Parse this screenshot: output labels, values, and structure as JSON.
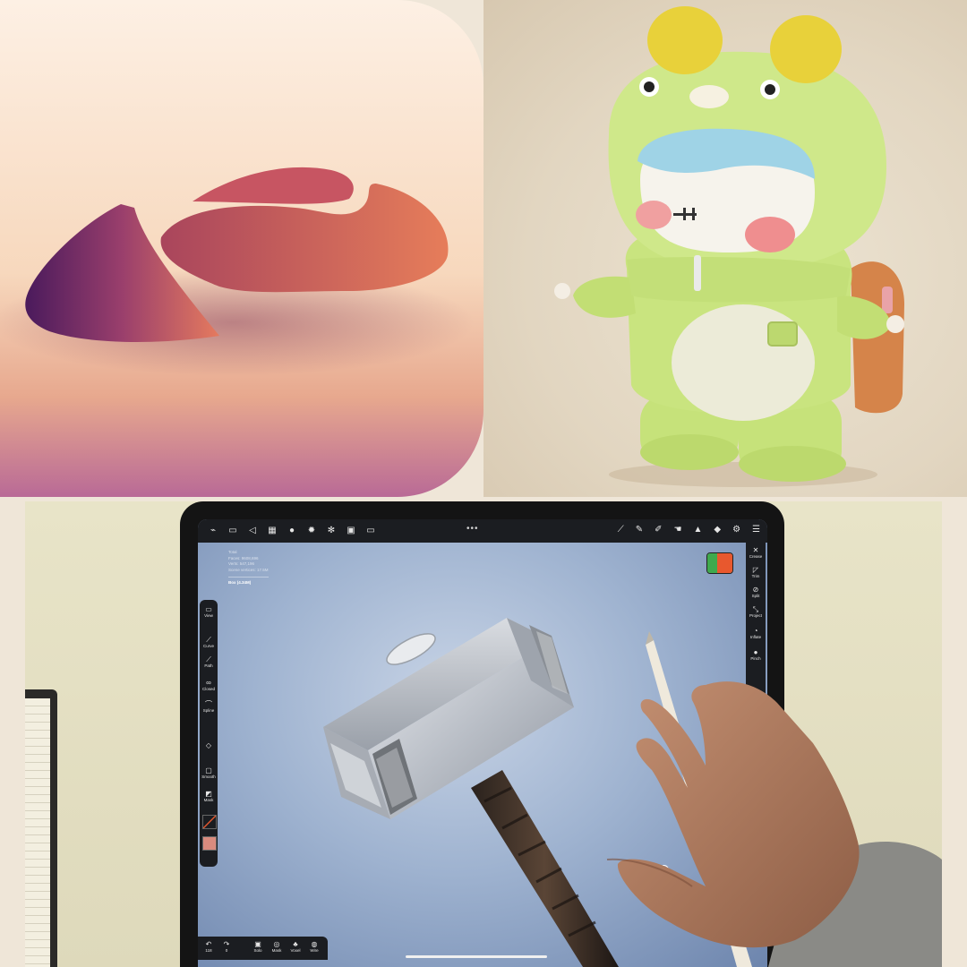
{
  "app_icon": {
    "name": "Nomad Sculpt app icon"
  },
  "viewport": {
    "stats": {
      "line1": "Total",
      "line2": "Faces: 9608,696",
      "line3": "Verts: 547,196",
      "line4": "Scene vertices: 17.5M",
      "selected": "Box (4.34M)"
    },
    "top_menu_dots": "•••"
  },
  "left_toolbar": {
    "items": [
      {
        "icon": "▭",
        "label": "View"
      },
      {
        "icon": "⟋",
        "label": "Curve"
      },
      {
        "icon": "⟋",
        "label": "Path"
      },
      {
        "icon": "∞",
        "label": "Closed"
      },
      {
        "icon": "⌒",
        "label": "Spline"
      },
      {
        "icon": "◇",
        "label": ""
      },
      {
        "icon": "▢",
        "label": "Smooth"
      },
      {
        "icon": "◩",
        "label": "Mask"
      }
    ]
  },
  "right_toolbar": {
    "items": [
      {
        "icon": "✕",
        "label": "Crease"
      },
      {
        "icon": "◸",
        "label": "Trim"
      },
      {
        "icon": "⊘",
        "label": "Split"
      },
      {
        "icon": "⤡",
        "label": "Project"
      },
      {
        "icon": "◔",
        "label": "Inflate"
      },
      {
        "icon": "●",
        "label": "Pinch"
      }
    ]
  },
  "bottom_toolbar": {
    "items": [
      {
        "icon": "↶",
        "label": "118"
      },
      {
        "icon": "↷",
        "label": "0"
      },
      {
        "icon": "▣",
        "label": "Solo"
      },
      {
        "icon": "◎",
        "label": "Mask"
      },
      {
        "icon": "♣",
        "label": "Voxel"
      },
      {
        "icon": "◍",
        "label": "Wire"
      }
    ]
  },
  "colors": {
    "swatch_primary": "#e8582e",
    "swatch_secondary": "#3fa94d",
    "toolbar_bg": "#1b1d21"
  }
}
